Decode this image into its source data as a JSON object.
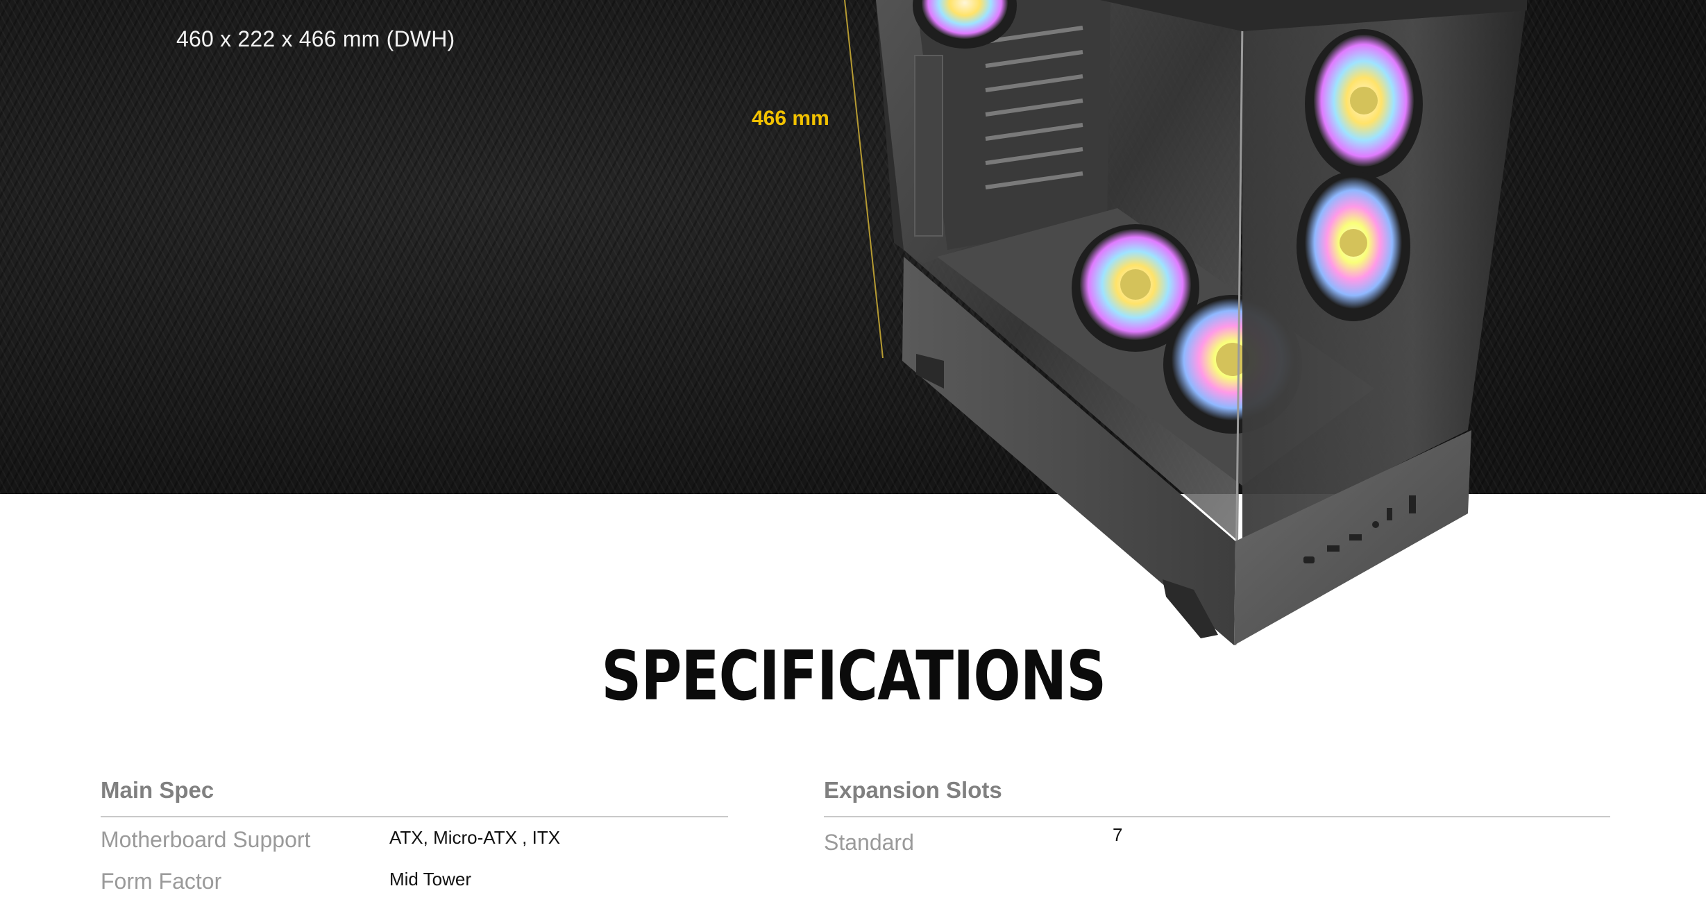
{
  "hero": {
    "dimensions_text": "460 x 222 x 466 mm (DWH)",
    "height_label": "466 mm",
    "accent_color": "#f2c200"
  },
  "specs": {
    "title": "SPECIFICATIONS",
    "sections": [
      {
        "heading": "Main Spec",
        "rows": [
          {
            "key": "Motherboard Support",
            "value": "ATX, Micro-ATX , ITX"
          },
          {
            "key": "Form Factor",
            "value": "Mid Tower"
          }
        ]
      },
      {
        "heading": "Expansion Slots",
        "rows": [
          {
            "key": "Standard",
            "value": "7"
          }
        ]
      }
    ]
  }
}
